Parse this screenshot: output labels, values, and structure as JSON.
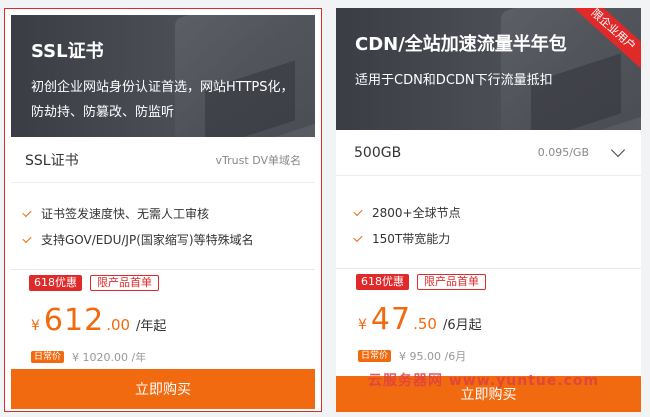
{
  "cards": [
    {
      "title": "SSL证书",
      "desc": "初创企业网站身份认证首选，网站HTTPS化，防劫持、防篡改、防监听",
      "spec_name": "SSL证书",
      "spec_sub": "vTrust DV单域名",
      "features": [
        "证书签发速度快、无需人工审核",
        "支持GOV/EDU/JP(国家缩写)等特殊域名"
      ],
      "badge_sale": "618优惠",
      "badge_limit": "限产品首单",
      "currency": "¥",
      "price_int": "612",
      "price_dec": ".00",
      "price_unit": "/年起",
      "daily_tag": "日常价",
      "old_price": "¥ 1020.00 /年",
      "buy_label": "立即购买"
    },
    {
      "title": "CDN/全站加速流量半年包",
      "desc": "适用于CDN和DCDN下行流量抵扣",
      "ribbon": "限企业用户",
      "spec_name": "500GB",
      "spec_sub": "0.095/GB",
      "features": [
        "2800+全球节点",
        "150T带宽能力"
      ],
      "badge_sale": "618优惠",
      "badge_limit": "限产品首单",
      "currency": "¥",
      "price_int": "47",
      "price_dec": ".50",
      "price_unit": "/6月起",
      "daily_tag": "日常价",
      "old_price": "¥ 95.00 /6月",
      "buy_label": "立即购买"
    }
  ],
  "watermark": "云服务器网 www.yuntue.com",
  "colors": {
    "accent": "#f26a10",
    "sale": "#e02a2a",
    "header": "#45474e"
  }
}
